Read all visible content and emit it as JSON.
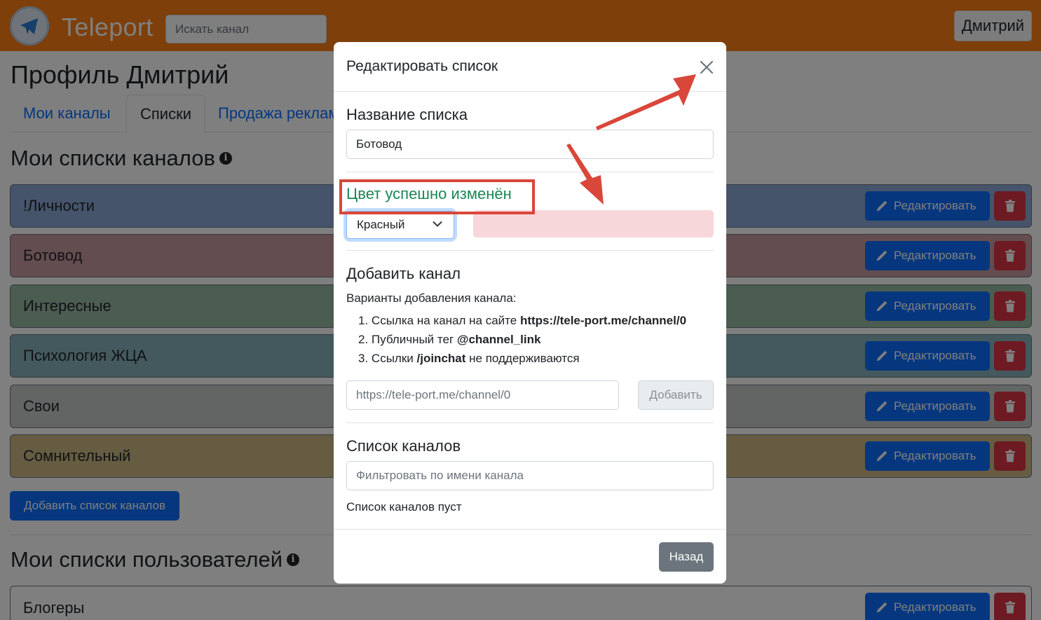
{
  "header": {
    "brand": "Teleport",
    "search_placeholder": "Искать канал",
    "user_name": "Дмитрий"
  },
  "page": {
    "title": "Профиль Дмитрий",
    "tabs": [
      {
        "label": "Мои каналы"
      },
      {
        "label": "Списки"
      },
      {
        "label": "Продажа реклам"
      }
    ],
    "channel_lists_title": "Мои списки каналов",
    "channel_lists": [
      {
        "label": "!Личности",
        "color": "#8aa8d6"
      },
      {
        "label": "Ботовод",
        "color": "#c99ba0"
      },
      {
        "label": "Интересные",
        "color": "#97b8a2"
      },
      {
        "label": "Психология ЖЦА",
        "color": "#87b3bd"
      },
      {
        "label": "Свои",
        "color": "#c7c8c9"
      },
      {
        "label": "Сомнительный",
        "color": "#cbb984"
      }
    ],
    "edit_label": "Редактировать",
    "add_list_label": "Добавить список каналов",
    "user_lists_title": "Мои списки пользователей",
    "user_lists": [
      {
        "label": "Блогеры"
      }
    ]
  },
  "modal": {
    "title": "Редактировать список",
    "name_label": "Название списка",
    "name_value": "Ботовод",
    "success_message": "Цвет успешно изменён",
    "color_value": "Красный",
    "color_preview": "#f8d7da",
    "add_channel_title": "Добавить канал",
    "add_options_label": "Варианты добавления канала:",
    "options": [
      {
        "num": "1.",
        "text": "Ссылка на канал на сайте ",
        "bold": "https://tele-port.me/channel/0",
        "tail": ""
      },
      {
        "num": "2.",
        "text": "Публичный тег ",
        "bold": "@channel_link",
        "tail": ""
      },
      {
        "num": "3.",
        "text": "Ссылки ",
        "bold": "/joinchat",
        "tail": " не поддерживаются"
      }
    ],
    "channel_input_placeholder": "https://tele-port.me/channel/0",
    "add_button": "Добавить",
    "channels_title": "Список каналов",
    "filter_placeholder": "Фильтровать по имени канала",
    "empty_text": "Список каналов пуст",
    "back_button": "Назад"
  },
  "colors": {
    "navbar": "#fd7e14",
    "primary": "#0d6efd",
    "danger": "#dc3545",
    "success": "#198754",
    "annotation": "#d9473a"
  }
}
